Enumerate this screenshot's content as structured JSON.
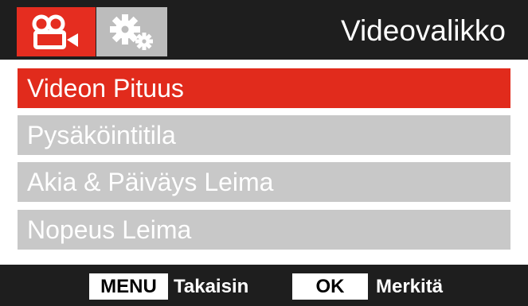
{
  "header": {
    "title": "Videovalikko",
    "tabs": [
      {
        "icon": "video-camera-icon",
        "active": true
      },
      {
        "icon": "gear-icon",
        "active": false
      }
    ]
  },
  "menu": {
    "items": [
      {
        "label": "Videon Pituus",
        "selected": true
      },
      {
        "label": "Pysäköintitila",
        "selected": false
      },
      {
        "label": "Akia & Päiväys Leima",
        "selected": false
      },
      {
        "label": "Nopeus Leima",
        "selected": false
      }
    ]
  },
  "footer": {
    "menu_key": "MENU",
    "menu_hint": "Takaisin",
    "ok_key": "OK",
    "ok_hint": "Merkitä"
  },
  "colors": {
    "accent": "#e52d20",
    "inactive_tab": "#bcbcbc",
    "inactive_item": "#c8c8c8",
    "background": "#1e1e1e",
    "panel": "#ffffff"
  }
}
